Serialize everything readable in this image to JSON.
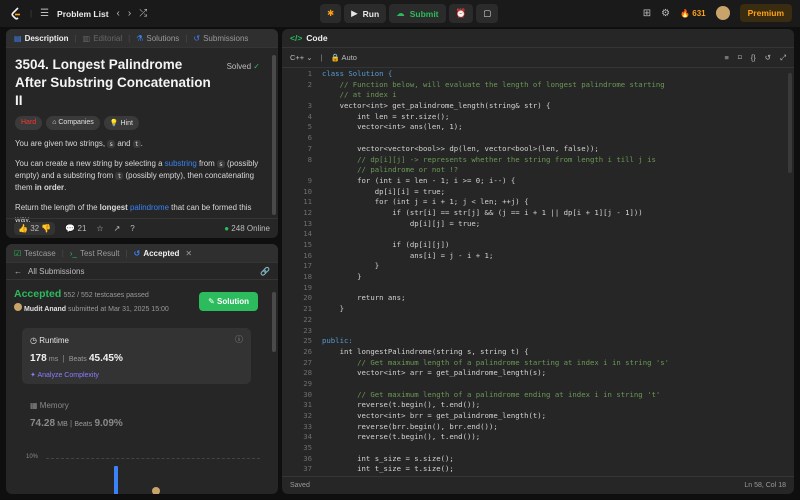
{
  "topbar": {
    "title": "Problem List",
    "run_label": "Run",
    "submit_label": "Submit",
    "streak": "631",
    "premium_label": "Premium"
  },
  "desc_tabs": [
    "Description",
    "Editorial",
    "Solutions",
    "Submissions"
  ],
  "problem": {
    "title": "3504. Longest Palindrome After Substring Concatenation II",
    "solved": "Solved",
    "chips": [
      "Hard",
      "Companies",
      "Hint"
    ],
    "p1_a": "You are given two strings, ",
    "s": "s",
    "and": " and ",
    "t": "t",
    "p2_a": "You can create a new string by selecting a ",
    "substring": "substring",
    "from": " from ",
    "p2_b": " (possibly empty) and a substring from ",
    "p2_c": " (possibly empty), then concatenating them ",
    "in_order": "in order",
    "p3_a": "Return the length of the ",
    "longest": "longest",
    "palindrome": "palindrome",
    "p3_b": " that can be formed this way.",
    "likes": "32",
    "comments": "21",
    "online": "248 Online"
  },
  "bottom_tabs": [
    "Testcase",
    "Test Result",
    "Accepted"
  ],
  "submission": {
    "back": "All Submissions",
    "status": "Accepted",
    "passed": "552 / 552 testcases passed",
    "user": "Mudit Anand",
    "submitted": "submitted at Mar 31, 2025 15:00",
    "solution_btn": "Solution",
    "runtime_label": "Runtime",
    "runtime_value": "178",
    "runtime_unit": "ms",
    "beats_label": "Beats",
    "runtime_beats": "45.45%",
    "analyze": "Analyze Complexity",
    "memory_label": "Memory",
    "memory_value": "74.28",
    "memory_unit": "MB",
    "memory_beats": "9.09%",
    "chart_tick": "10%"
  },
  "editor": {
    "title": "Code",
    "lang": "C++",
    "auto": "Auto",
    "saved": "Saved",
    "cursor": "Ln 58, Col 18",
    "lines": [
      {
        "n": "1",
        "t": "class Solution {"
      },
      {
        "n": "2",
        "t": "    // Function below, will evaluate the length of longest palindrome starting"
      },
      {
        "n": "",
        "t": "    // at index i"
      },
      {
        "n": "3",
        "t": "    vector<int> get_palindrome_length(string& str) {"
      },
      {
        "n": "4",
        "t": "        int len = str.size();"
      },
      {
        "n": "5",
        "t": "        vector<int> ans(len, 1);"
      },
      {
        "n": "6",
        "t": ""
      },
      {
        "n": "7",
        "t": "        vector<vector<bool>> dp(len, vector<bool>(len, false));"
      },
      {
        "n": "8",
        "t": "        // dp[i][j] -> represents whether the string from length i till j is"
      },
      {
        "n": "",
        "t": "        // palindrome or not !?"
      },
      {
        "n": "9",
        "t": "        for (int i = len - 1; i >= 0; i--) {"
      },
      {
        "n": "10",
        "t": "            dp[i][i] = true;"
      },
      {
        "n": "11",
        "t": "            for (int j = i + 1; j < len; ++j) {"
      },
      {
        "n": "12",
        "t": "                if (str[i] == str[j] && (j == i + 1 || dp[i + 1][j - 1]))"
      },
      {
        "n": "13",
        "t": "                    dp[i][j] = true;"
      },
      {
        "n": "14",
        "t": ""
      },
      {
        "n": "15",
        "t": "                if (dp[i][j])"
      },
      {
        "n": "16",
        "t": "                    ans[i] = j - i + 1;"
      },
      {
        "n": "17",
        "t": "            }"
      },
      {
        "n": "18",
        "t": "        }"
      },
      {
        "n": "19",
        "t": ""
      },
      {
        "n": "20",
        "t": "        return ans;"
      },
      {
        "n": "21",
        "t": "    }"
      },
      {
        "n": "22",
        "t": ""
      },
      {
        "n": "23",
        "t": ""
      },
      {
        "n": "25",
        "t": "public:"
      },
      {
        "n": "26",
        "t": "    int longestPalindrome(string s, string t) {"
      },
      {
        "n": "27",
        "t": "        // Get maximum length of a palindrome starting at index i in string 's'"
      },
      {
        "n": "28",
        "t": "        vector<int> arr = get_palindrome_length(s);"
      },
      {
        "n": "29",
        "t": ""
      },
      {
        "n": "30",
        "t": "        // Get maximum length of a palindrome ending at index i in string 't'"
      },
      {
        "n": "31",
        "t": "        reverse(t.begin(), t.end());"
      },
      {
        "n": "32",
        "t": "        vector<int> brr = get_palindrome_length(t);"
      },
      {
        "n": "33",
        "t": "        reverse(brr.begin(), brr.end());"
      },
      {
        "n": "34",
        "t": "        reverse(t.begin(), t.end());"
      },
      {
        "n": "35",
        "t": ""
      },
      {
        "n": "36",
        "t": "        int s_size = s.size();"
      },
      {
        "n": "37",
        "t": "        int t_size = t.size();"
      }
    ]
  }
}
